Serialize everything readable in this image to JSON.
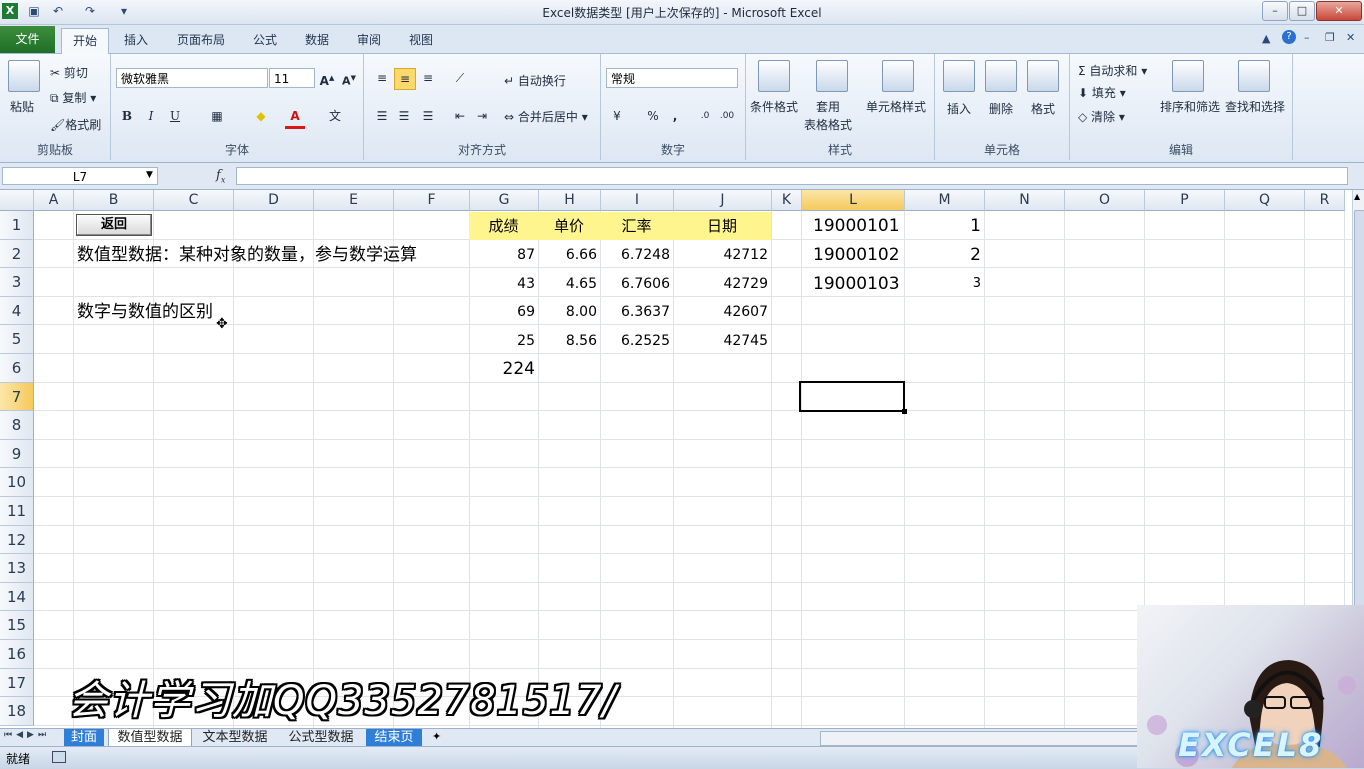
{
  "window": {
    "title": "Excel数据类型 [用户上次保存的] - Microsoft Excel",
    "controls": [
      "–",
      "□",
      "✕"
    ]
  },
  "menu": {
    "tabs": [
      "文件",
      "开始",
      "插入",
      "页面布局",
      "公式",
      "数据",
      "审阅",
      "视图"
    ],
    "active": "开始"
  },
  "ribbon": {
    "clipboard": {
      "paste": "粘贴",
      "cut": "剪切",
      "copy": "复制",
      "format_painter": "格式刷",
      "label": "剪贴板"
    },
    "font": {
      "name": "微软雅黑",
      "size": "11",
      "bold": "B",
      "italic": "I",
      "underline": "U",
      "label": "字体"
    },
    "alignment": {
      "wrap": "自动换行",
      "merge": "合并后居中",
      "label": "对齐方式"
    },
    "number": {
      "format": "常规",
      "percent": "%",
      "comma": ",",
      "label": "数字"
    },
    "styles": {
      "conditional": "条件格式",
      "table": "套用\n表格格式",
      "cell_styles": "单元格样式",
      "label": "样式"
    },
    "cells": {
      "insert": "插入",
      "delete": "删除",
      "format": "格式",
      "label": "单元格"
    },
    "editing": {
      "autosum": "自动求和",
      "fill": "填充",
      "clear": "清除",
      "sort": "排序和筛选",
      "find": "查找和选择",
      "label": "编辑"
    }
  },
  "formula_bar": {
    "name_box": "L7",
    "fx": "f",
    "formula": ""
  },
  "columns": [
    "A",
    "B",
    "C",
    "D",
    "E",
    "F",
    "G",
    "H",
    "I",
    "J",
    "K",
    "L",
    "M",
    "N",
    "O",
    "P",
    "Q",
    "R"
  ],
  "selected_column": "L",
  "rows": [
    "1",
    "2",
    "3",
    "4",
    "5",
    "6",
    "7",
    "8",
    "9",
    "10",
    "11",
    "12",
    "13",
    "14",
    "15",
    "16",
    "17",
    "18"
  ],
  "selected_row": "7",
  "cells": {
    "b1_button": "返回",
    "b2": "数值型数据：某种对象的数量，参与数学运算",
    "b4": "数字与数值的区别",
    "g1": "成绩",
    "h1": "单价",
    "i1": "汇率",
    "j1": "日期",
    "g2": "87",
    "h2": "6.66",
    "i2": "6.7248",
    "j2": "42712",
    "g3": "43",
    "h3": "4.65",
    "i3": "6.7606",
    "j3": "42729",
    "g4": "69",
    "h4": "8.00",
    "i4": "6.3637",
    "j4": "42607",
    "g5": "25",
    "h5": "8.56",
    "i5": "6.2525",
    "j5": "42745",
    "g6": "224",
    "l1": "19000101",
    "m1": "1",
    "l2": "19000102",
    "m2": "2",
    "l3": "19000103",
    "m3": "3"
  },
  "sheets": {
    "tabs": [
      "封面",
      "数值型数据",
      "文本型数据",
      "公式型数据",
      "结束页"
    ],
    "active": "数值型数据"
  },
  "status": {
    "text": "就绪"
  },
  "overlay": {
    "watermark": "会计学习加QQ3352781517/",
    "logo": "EXCEL8"
  },
  "colors": {
    "header_fill": "#fff58f",
    "file_tab": "#2a7d33",
    "selected_header": "#f5c95c"
  }
}
